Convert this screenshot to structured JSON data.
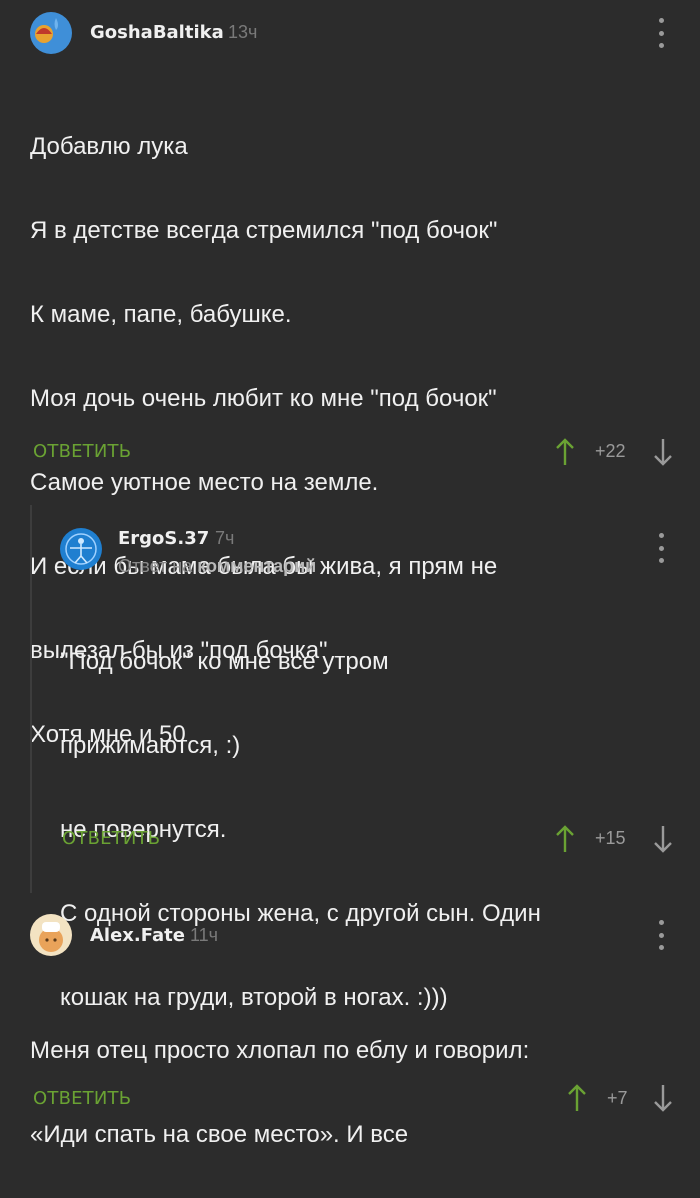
{
  "comments": [
    {
      "author": "GoshaBaltika",
      "time": "13ч",
      "lines": [
        "Добавлю лука",
        "Я в детстве всегда стремился \"под бочок\"",
        "К маме, папе, бабушке.",
        "Моя дочь очень любит ко мне \"под бочок\"",
        "Самое уютное место на земле.",
        "И если бы мама была бы жива, я прям не",
        "вылезал бы из \"под бочка\"",
        "Хотя мне и 50"
      ],
      "reply_label": "ОТВЕТИТЬ",
      "score": "+22"
    },
    {
      "author": "ErgoS.37",
      "time": "7ч",
      "reply_to_prefix": "Ответ на",
      "reply_to_target": "комментарий",
      "lines": [
        "\"Под бочок\" ко мне все утром",
        "прижимаются, :)",
        "не повернутся.",
        "С одной стороны жена, с другой сын. Один",
        "кошак на груди, второй в ногах. :)))"
      ],
      "reply_label": "ОТВЕТИТЬ",
      "score": "+15"
    },
    {
      "author": "Alex.Fate",
      "time": "11ч",
      "lines": [
        "Меня отец просто хлопал по еблу и говорил:",
        "«Иди спать на свое место». И все"
      ],
      "reply_label": "ОТВЕТИТЬ",
      "score": "+7"
    }
  ],
  "colors": {
    "background": "#2c2c2c",
    "accent": "#6aa233",
    "muted": "#7a7a7a"
  }
}
